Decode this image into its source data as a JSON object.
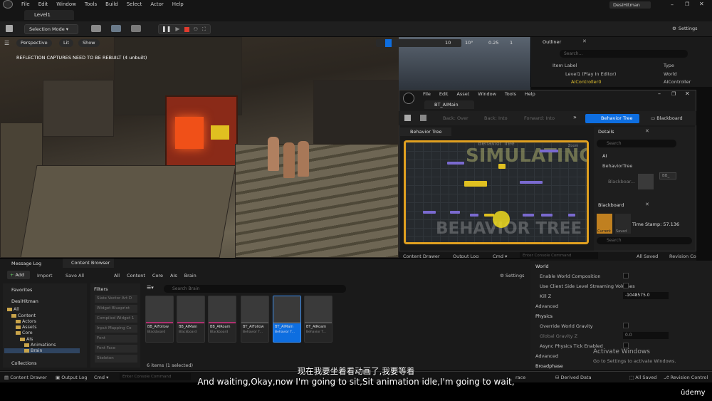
{
  "menubar": {
    "items": [
      "File",
      "Edit",
      "Window",
      "Tools",
      "Build",
      "Select",
      "Actor",
      "Help"
    ],
    "user": "DesiHitman"
  },
  "tabs": {
    "level": "Level1"
  },
  "toolbar": {
    "mode": "Selection Mode",
    "settings": "Settings"
  },
  "viewport": {
    "perspective": "Perspective",
    "lit": "Lit",
    "show": "Show",
    "warning": "REFLECTION CAPTURES NEED TO BE REBUILT (4 unbuilt)",
    "grid": "10",
    "angle": "10°",
    "scale": "0.25",
    "cam": "1"
  },
  "outliner": {
    "title": "Outliner",
    "search_placeholder": "Search...",
    "col_label": "Item Label",
    "col_type": "Type",
    "rows": [
      {
        "label": "Level1 (Play In Editor)",
        "type": "World"
      },
      {
        "label": "AIController0",
        "type": "AIController"
      }
    ]
  },
  "bt_window": {
    "menu": [
      "File",
      "Edit",
      "Asset",
      "Window",
      "Tools",
      "Help"
    ],
    "tab": "BT_AIMain",
    "back_over": "Back: Over",
    "back_into": "Back: Into",
    "forward_into": "Forward: Into",
    "behavior_tree_btn": "Behavior Tree",
    "blackboard_btn": "Blackboard",
    "graph_tab": "Behavior Tree",
    "graph_title": "Behavior Tree",
    "simulating": "SIMULATING",
    "watermark": "BEHAVIOR TREE",
    "zoom": "Zoom",
    "details_tab": "Details",
    "details_search": "Search",
    "ai_section": "AI",
    "bt_prop": "BehaviorTree",
    "blackboard_dim": "Blackboar...",
    "asset_chip": "BB_",
    "blackboard_tab": "Blackboard",
    "timestamp": "Time Stamp: 57.136",
    "current": "Current",
    "saved": "Saved",
    "bb_search": "Search",
    "content_drawer": "Content Drawer",
    "output_log": "Output Log",
    "cmd": "Cmd",
    "console": "Enter Console Command",
    "all_saved": "All Saved",
    "revision": "Revision Co"
  },
  "bottom": {
    "tab_message": "Message Log",
    "tab_content": "Content Browser",
    "add": "Add",
    "import": "Import",
    "save_all": "Save All",
    "breadcrumb": [
      "All",
      "Content",
      "Core",
      "AIs",
      "Brain"
    ],
    "settings": "Settings",
    "favorites": "Favorites",
    "project": "DesiHitman",
    "tree": [
      "All",
      "Content",
      "Actors",
      "Assets",
      "Core",
      "AIs",
      "Animations",
      "Brain"
    ],
    "collections": "Collections",
    "filters": "Filters",
    "filter_items": [
      "Slate Vector Art D",
      "Widget Blueprint",
      "Compiled Widget 1",
      "Input Mapping Co",
      "Font",
      "Font Face",
      "Skeleton"
    ],
    "search_placeholder": "Search Brain",
    "items_count": "6 items (1 selected)",
    "assets": [
      {
        "name": "BB_AIFollow",
        "type": "Blackboard"
      },
      {
        "name": "BB_AIMain",
        "type": "Blackboard"
      },
      {
        "name": "BB_AIRoam",
        "type": "Blackboard"
      },
      {
        "name": "BT_AIFollow",
        "type": "Behavior T..."
      },
      {
        "name": "BT_AIMain",
        "type": "Behavior T..."
      },
      {
        "name": "BT_AIRoam",
        "type": "Behavior T..."
      }
    ]
  },
  "world_settings": {
    "world": "World",
    "enable_comp": "Enable World Composition",
    "client_stream": "Use Client Side Level Streaming Volumes",
    "kill_z": "Kill Z",
    "kill_z_val": "-1048575.0",
    "advanced": "Advanced",
    "physics": "Physics",
    "override_gravity": "Override World Gravity",
    "global_gravity": "Global Gravity Z",
    "gravity_val": "0.0",
    "async_tick": "Async Physics Tick Enabled",
    "advanced2": "Advanced",
    "broadphase": "Broadphase"
  },
  "statusbar": {
    "content_drawer": "Content Drawer",
    "output_log": "Output Log",
    "cmd": "Cmd",
    "console": "Enter Console Command",
    "trace": "race",
    "derived": "Derived Data",
    "all_saved": "All Saved",
    "revision": "Revision Control"
  },
  "activate": {
    "title": "Activate Windows",
    "sub": "Go to Settings to activate Windows."
  },
  "subtitles": {
    "zh": "现在我要坐着看动画了,我要等着",
    "en": "And waiting,Okay,now I'm going to sit,Sit animation idle,I'm going to wait,"
  },
  "brand": "ûdemy",
  "colors": {
    "accent": "#0e6ee0",
    "highlight": "#e0a020",
    "bt_node": "#7a6ad0",
    "asset_pink": "#b03070"
  }
}
